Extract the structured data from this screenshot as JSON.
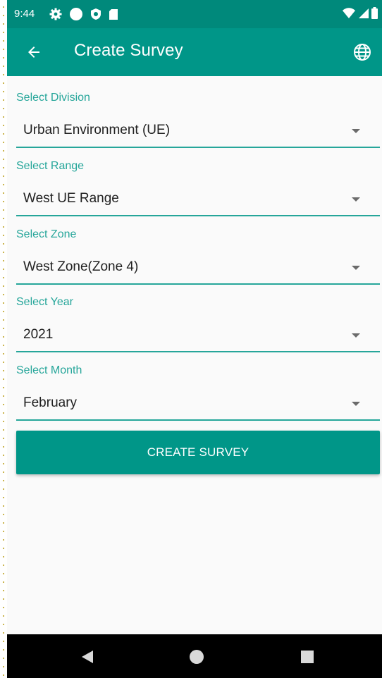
{
  "status_bar": {
    "time": "9:44",
    "icons_left": [
      "settings-icon",
      "circle-icon",
      "shield-icon",
      "sd-card-icon"
    ],
    "icons_right": [
      "wifi-icon",
      "signal-icon",
      "battery-icon"
    ]
  },
  "app_bar": {
    "title": "Create Survey",
    "back_icon": "arrow-back-icon",
    "action_icon": "globe-icon"
  },
  "form": {
    "fields": [
      {
        "label": "Select Division",
        "value": "Urban Environment (UE)"
      },
      {
        "label": "Select Range",
        "value": "West UE Range"
      },
      {
        "label": "Select Zone",
        "value": "West Zone(Zone 4)"
      },
      {
        "label": "Select Year",
        "value": "2021"
      },
      {
        "label": "Select Month",
        "value": "February"
      }
    ],
    "submit_label": "CREATE SURVEY"
  },
  "nav_bar": {
    "icons": [
      "nav-back-icon",
      "nav-home-icon",
      "nav-recents-icon"
    ]
  },
  "colors": {
    "status_bar": "#00897b",
    "app_bar": "#009688",
    "accent": "#26a69a",
    "background": "#fafafa"
  }
}
